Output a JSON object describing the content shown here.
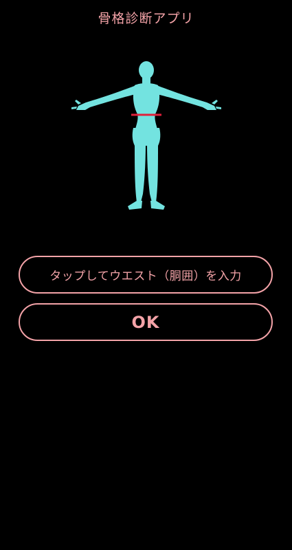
{
  "app": {
    "title": "骨格診断アプリ"
  },
  "figure": {
    "icon": "body-silhouette-icon",
    "body_color": "#73e3e0",
    "waist_marker_color": "#e0203a"
  },
  "form": {
    "waist_input_label": "タップしてウエスト（胴囲）を入力",
    "ok_label": "OK"
  },
  "colors": {
    "background": "#000000",
    "accent": "#f4a3a8"
  }
}
